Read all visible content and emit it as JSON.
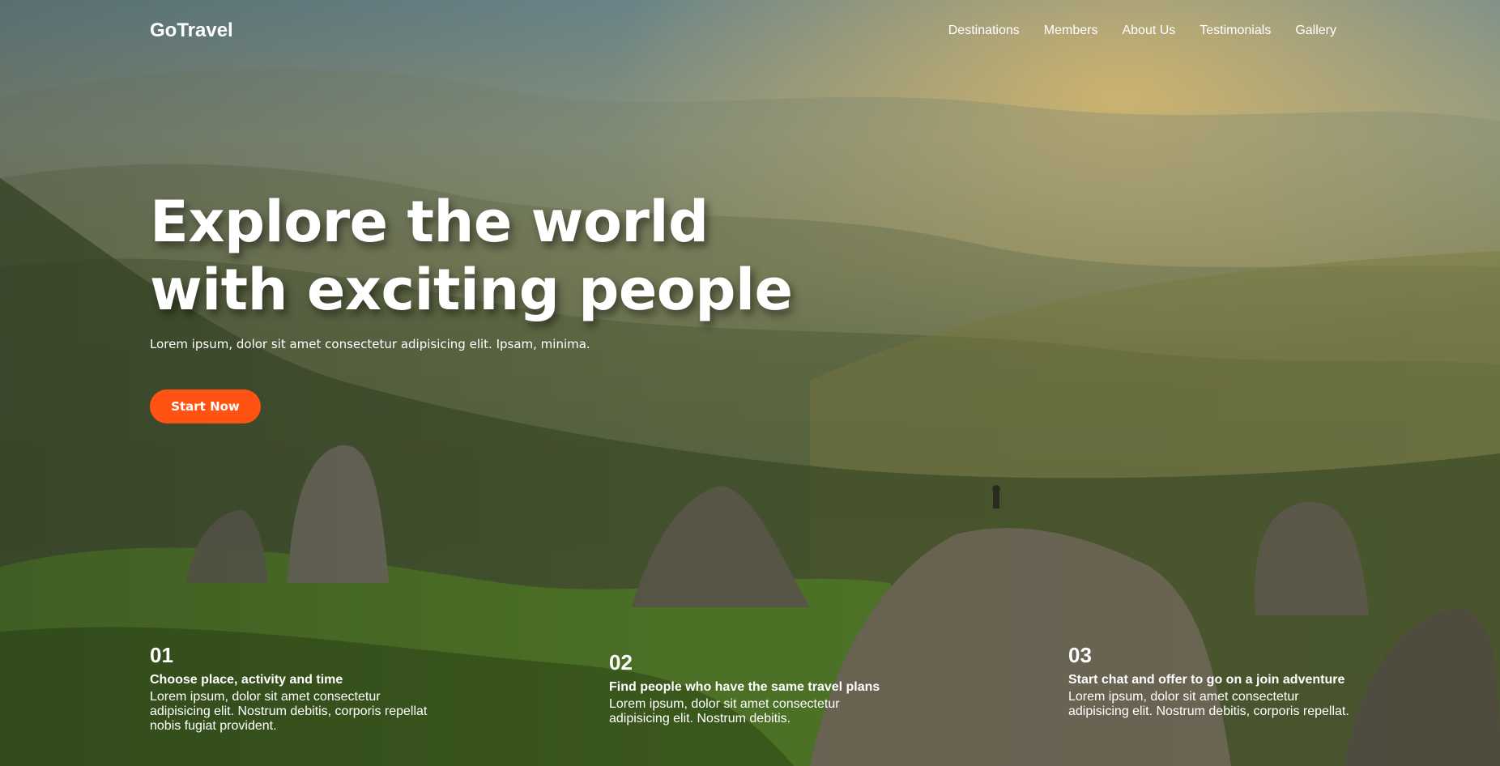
{
  "header": {
    "brand": "GoTravel",
    "nav": [
      {
        "label": "Destinations"
      },
      {
        "label": "Members"
      },
      {
        "label": "About Us"
      },
      {
        "label": "Testimonials"
      },
      {
        "label": "Gallery"
      }
    ]
  },
  "hero": {
    "title_line1": "Explore the world",
    "title_line2": "with exciting people",
    "subtitle": "Lorem ipsum, dolor sit amet consectetur adipisicing elit. Ipsam, minima.",
    "cta_label": "Start Now"
  },
  "steps": [
    {
      "number": "01",
      "title": "Choose place, activity and time",
      "text": "Lorem ipsum, dolor sit amet consectetur adipisicing elit. Nostrum debitis, corporis repellat nobis fugiat provident."
    },
    {
      "number": "02",
      "title": "Find people who have the same travel plans",
      "text": "Lorem ipsum, dolor sit amet consectetur adipisicing elit. Nostrum debitis."
    },
    {
      "number": "03",
      "title": "Start chat and offer to go on a join adventure",
      "text": "Lorem ipsum, dolor sit amet consectetur adipisicing elit. Nostrum debitis, corporis repellat."
    }
  ],
  "colors": {
    "accent": "#ff5314",
    "text": "#ffffff"
  }
}
